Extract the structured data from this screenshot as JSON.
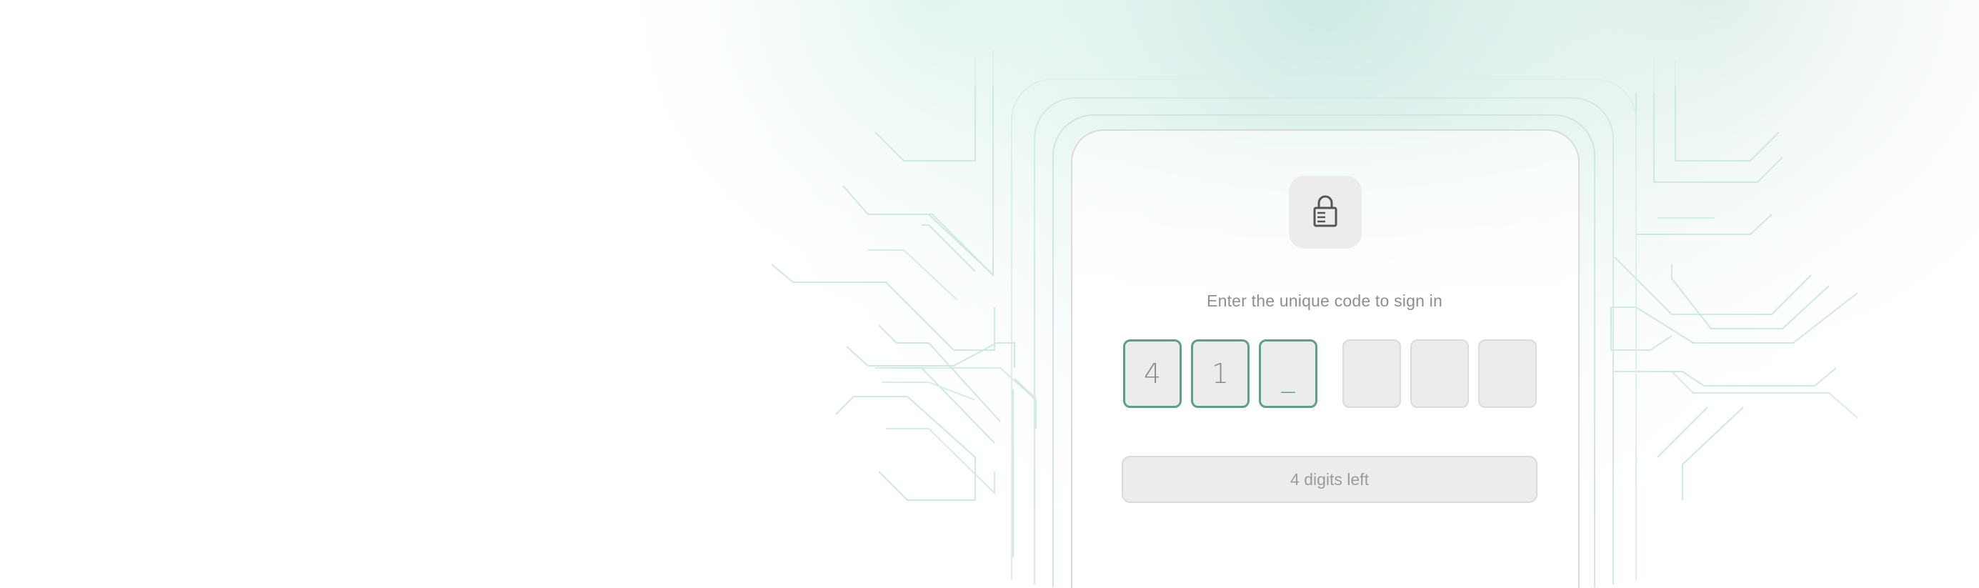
{
  "auth": {
    "icon": "lock-icon",
    "prompt": "Enter the unique code to sign in",
    "code_digits": [
      "4",
      "1",
      "_",
      "",
      "",
      ""
    ],
    "status": "4 digits left"
  },
  "colors": {
    "accent": "#5f9e8c",
    "circuit": "#cfe8e3",
    "tile": "#ececec",
    "text_muted": "#8f8f8f"
  }
}
